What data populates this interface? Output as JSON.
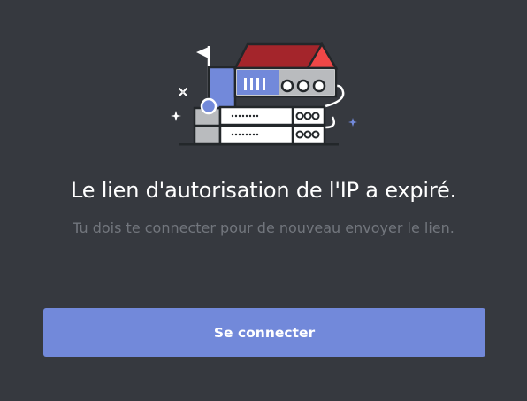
{
  "dialog": {
    "title": "Le lien d'autorisation de l'IP a expiré.",
    "subtitle": "Tu dois te connecter pour de nouveau envoyer le lien.",
    "login_button": "Se connecter"
  },
  "colors": {
    "background": "#36393f",
    "button": "#7289da",
    "title_text": "#ffffff",
    "subtitle_text": "#72767d",
    "roof_red": "#a4252b",
    "roof_accent": "#f04747"
  },
  "icons": {
    "illustration": "server-house-icon"
  }
}
